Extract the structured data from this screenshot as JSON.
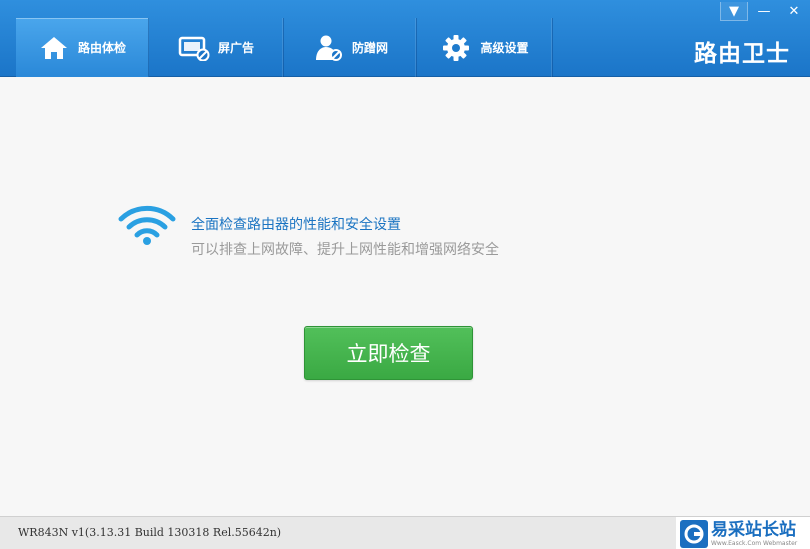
{
  "header": {
    "tabs": [
      {
        "label": "路由体检",
        "icon": "home-icon",
        "active": true
      },
      {
        "label": "屏广告",
        "icon": "block-ads-icon",
        "active": false
      },
      {
        "label": "防蹭网",
        "icon": "anti-freeload-icon",
        "active": false
      },
      {
        "label": "高级设置",
        "icon": "gear-icon",
        "active": false
      }
    ],
    "brand": "路由卫士",
    "window_controls": {
      "menu": "▼",
      "minimize": "—",
      "close": "✕"
    }
  },
  "main": {
    "title": "全面检查路由器的性能和安全设置",
    "subtitle": "可以排查上网故障、提升上网性能和增强网络安全",
    "check_button": "立即检查"
  },
  "status": {
    "version": "WR843N v1(3.13.31 Build 130318 Rel.55642n)"
  },
  "watermark": {
    "name": "易采站长站",
    "url": "Www.Easck.Com  Webmaster"
  },
  "colors": {
    "header_blue": "#1b75c8",
    "accent_blue": "#1b74c2",
    "button_green": "#3aa943"
  }
}
